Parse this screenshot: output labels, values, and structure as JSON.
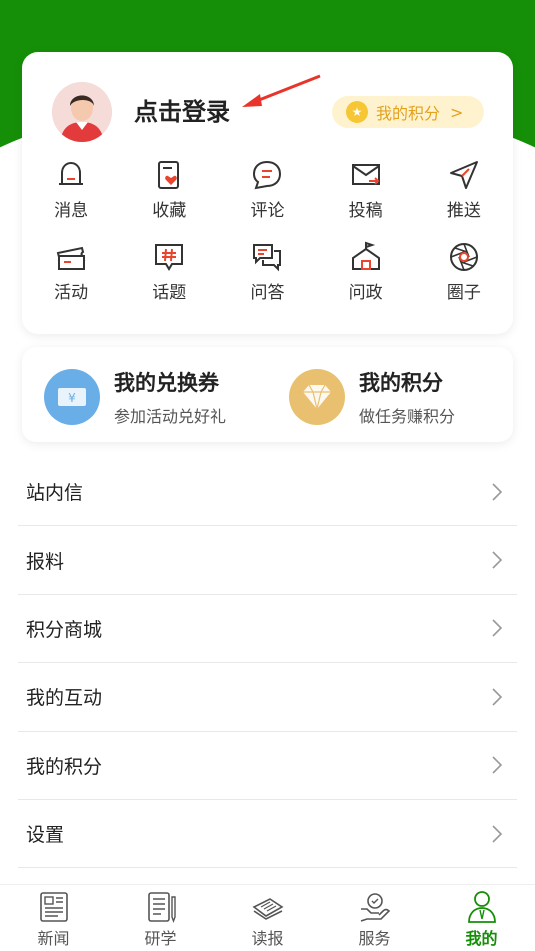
{
  "header": {
    "login_text": "点击登录",
    "points_label": "我的积分",
    "points_chevron": ">"
  },
  "quick_actions": [
    {
      "label": "消息",
      "icon": "bell-icon"
    },
    {
      "label": "收藏",
      "icon": "favorite-icon"
    },
    {
      "label": "评论",
      "icon": "comment-icon"
    },
    {
      "label": "投稿",
      "icon": "submit-mail-icon"
    },
    {
      "label": "推送",
      "icon": "send-icon"
    },
    {
      "label": "活动",
      "icon": "ticket-icon"
    },
    {
      "label": "话题",
      "icon": "topic-icon"
    },
    {
      "label": "问答",
      "icon": "qa-icon"
    },
    {
      "label": "问政",
      "icon": "government-icon"
    },
    {
      "label": "圈子",
      "icon": "aperture-icon"
    }
  ],
  "coupons": {
    "voucher": {
      "title": "我的兑换券",
      "subtitle": "参加活动兑好礼",
      "color": "#6aaee8"
    },
    "points": {
      "title": "我的积分",
      "subtitle": "做任务赚积分",
      "color": "#e9c070"
    }
  },
  "menu": [
    "站内信",
    "报料",
    "积分商城",
    "我的互动",
    "我的积分",
    "设置"
  ],
  "tabbar": [
    {
      "label": "新闻",
      "icon": "newspaper-icon",
      "active": false
    },
    {
      "label": "研学",
      "icon": "study-icon",
      "active": false
    },
    {
      "label": "读报",
      "icon": "read-paper-icon",
      "active": false
    },
    {
      "label": "服务",
      "icon": "service-icon",
      "active": false
    },
    {
      "label": "我的",
      "icon": "profile-icon",
      "active": true
    }
  ],
  "colors": {
    "brand_green": "#168f08",
    "accent_red": "#e8442e",
    "gold": "#e2a21f"
  }
}
